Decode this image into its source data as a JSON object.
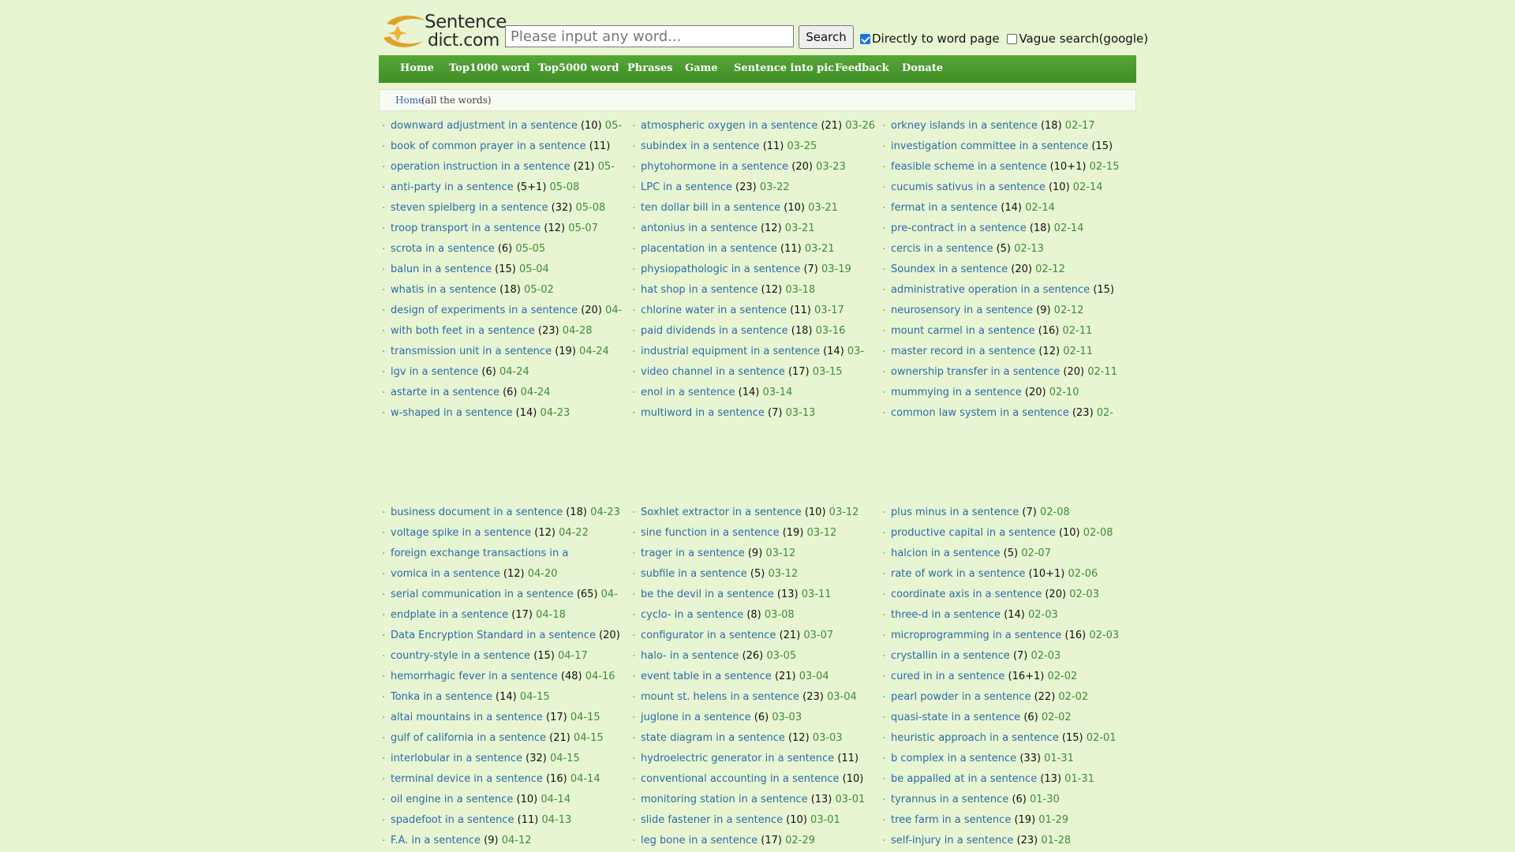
{
  "logo": {
    "line1": "Sentence",
    "line2": "dict.com"
  },
  "search": {
    "placeholder": "Please input any word...",
    "button": "Search"
  },
  "options": {
    "direct_label": "Directly to word page",
    "vague_label": "Vague search(google)"
  },
  "nav": [
    "Home",
    "Top1000 word",
    "Top5000 word",
    "Phrases",
    "Game",
    "Sentence into pic",
    "Feedback",
    "Donate"
  ],
  "breadcrumb": {
    "home": "Home",
    "rest": "(all the words)"
  },
  "columns_top": [
    [
      {
        "w": "downward adjustment in a sentence",
        "c": "(10)",
        "d": "05-"
      },
      {
        "w": "book of common prayer in a sentence",
        "c": "(11)",
        "d": ""
      },
      {
        "w": "operation instruction in a sentence",
        "c": "(21)",
        "d": "05-"
      },
      {
        "w": "anti-party in a sentence",
        "c": "(5+1)",
        "d": "05-08"
      },
      {
        "w": "steven spielberg in a sentence",
        "c": "(32)",
        "d": "05-08"
      },
      {
        "w": "troop transport in a sentence",
        "c": "(12)",
        "d": "05-07"
      },
      {
        "w": "scrota in a sentence",
        "c": "(6)",
        "d": "05-05"
      },
      {
        "w": "balun in a sentence",
        "c": "(15)",
        "d": "05-04"
      },
      {
        "w": "whatis in a sentence",
        "c": "(18)",
        "d": "05-02"
      },
      {
        "w": "design of experiments in a sentence",
        "c": "(20)",
        "d": "04-"
      },
      {
        "w": "with both feet in a sentence",
        "c": "(23)",
        "d": "04-28"
      },
      {
        "w": "transmission unit in a sentence",
        "c": "(19)",
        "d": "04-24"
      },
      {
        "w": "lgv in a sentence",
        "c": "(6)",
        "d": "04-24"
      },
      {
        "w": "astarte in a sentence",
        "c": "(6)",
        "d": "04-24"
      },
      {
        "w": "w-shaped in a sentence",
        "c": "(14)",
        "d": "04-23"
      }
    ],
    [
      {
        "w": "atmospheric oxygen in a sentence",
        "c": "(21)",
        "d": "03-26"
      },
      {
        "w": "subindex in a sentence",
        "c": "(11)",
        "d": "03-25"
      },
      {
        "w": "phytohormone in a sentence",
        "c": "(20)",
        "d": "03-23"
      },
      {
        "w": "LPC in a sentence",
        "c": "(23)",
        "d": "03-22"
      },
      {
        "w": "ten dollar bill in a sentence",
        "c": "(10)",
        "d": "03-21"
      },
      {
        "w": "antonius in a sentence",
        "c": "(12)",
        "d": "03-21"
      },
      {
        "w": "placentation in a sentence",
        "c": "(11)",
        "d": "03-21"
      },
      {
        "w": "physiopathologic in a sentence",
        "c": "(7)",
        "d": "03-19"
      },
      {
        "w": "hat shop in a sentence",
        "c": "(12)",
        "d": "03-18"
      },
      {
        "w": "chlorine water in a sentence",
        "c": "(11)",
        "d": "03-17"
      },
      {
        "w": "paid dividends in a sentence",
        "c": "(18)",
        "d": "03-16"
      },
      {
        "w": "industrial equipment in a sentence",
        "c": "(14)",
        "d": "03-"
      },
      {
        "w": "video channel in a sentence",
        "c": "(17)",
        "d": "03-15"
      },
      {
        "w": "enol in a sentence",
        "c": "(14)",
        "d": "03-14"
      },
      {
        "w": "multiword in a sentence",
        "c": "(7)",
        "d": "03-13"
      }
    ],
    [
      {
        "w": "orkney islands in a sentence",
        "c": "(18)",
        "d": "02-17"
      },
      {
        "w": "investigation committee in a sentence",
        "c": "(15)",
        "d": ""
      },
      {
        "w": "feasible scheme in a sentence",
        "c": "(10+1)",
        "d": "02-15"
      },
      {
        "w": "cucumis sativus in a sentence",
        "c": "(10)",
        "d": "02-14"
      },
      {
        "w": "fermat in a sentence",
        "c": "(14)",
        "d": "02-14"
      },
      {
        "w": "pre-contract in a sentence",
        "c": "(18)",
        "d": "02-14"
      },
      {
        "w": "cercis in a sentence",
        "c": "(5)",
        "d": "02-13"
      },
      {
        "w": "Soundex in a sentence",
        "c": "(20)",
        "d": "02-12"
      },
      {
        "w": "administrative operation in a sentence",
        "c": "(15)",
        "d": ""
      },
      {
        "w": "neurosensory in a sentence",
        "c": "(9)",
        "d": "02-12"
      },
      {
        "w": "mount carmel in a sentence",
        "c": "(16)",
        "d": "02-11"
      },
      {
        "w": "master record in a sentence",
        "c": "(12)",
        "d": "02-11"
      },
      {
        "w": "ownership transfer in a sentence",
        "c": "(20)",
        "d": "02-11"
      },
      {
        "w": "mummying in a sentence",
        "c": "(20)",
        "d": "02-10"
      },
      {
        "w": "common law system in a sentence",
        "c": "(23)",
        "d": "02-"
      }
    ]
  ],
  "columns_bottom": [
    [
      {
        "w": "business document in a sentence",
        "c": "(18)",
        "d": "04-23"
      },
      {
        "w": "voltage spike in a sentence",
        "c": "(12)",
        "d": "04-22"
      },
      {
        "w": "foreign exchange transactions in a",
        "c": "",
        "d": ""
      },
      {
        "w": "vomica in a sentence",
        "c": "(12)",
        "d": "04-20"
      },
      {
        "w": "serial communication in a sentence",
        "c": "(65)",
        "d": "04-"
      },
      {
        "w": "endplate in a sentence",
        "c": "(17)",
        "d": "04-18"
      },
      {
        "w": "Data Encryption Standard in a sentence",
        "c": "(20)",
        "d": ""
      },
      {
        "w": "country-style in a sentence",
        "c": "(15)",
        "d": "04-17"
      },
      {
        "w": "hemorrhagic fever in a sentence",
        "c": "(48)",
        "d": "04-16"
      },
      {
        "w": "Tonka in a sentence",
        "c": "(14)",
        "d": "04-15"
      },
      {
        "w": "altai mountains in a sentence",
        "c": "(17)",
        "d": "04-15"
      },
      {
        "w": "gulf of california in a sentence",
        "c": "(21)",
        "d": "04-15"
      },
      {
        "w": "interlobular in a sentence",
        "c": "(32)",
        "d": "04-15"
      },
      {
        "w": "terminal device in a sentence",
        "c": "(16)",
        "d": "04-14"
      },
      {
        "w": "oil engine in a sentence",
        "c": "(10)",
        "d": "04-14"
      },
      {
        "w": "spadefoot in a sentence",
        "c": "(11)",
        "d": "04-13"
      },
      {
        "w": "F.A. in a sentence",
        "c": "(9)",
        "d": "04-12"
      }
    ],
    [
      {
        "w": "Soxhlet extractor in a sentence",
        "c": "(10)",
        "d": "03-12"
      },
      {
        "w": "sine function in a sentence",
        "c": "(19)",
        "d": "03-12"
      },
      {
        "w": "trager in a sentence",
        "c": "(9)",
        "d": "03-12"
      },
      {
        "w": "subfile in a sentence",
        "c": "(5)",
        "d": "03-12"
      },
      {
        "w": "be the devil in a sentence",
        "c": "(13)",
        "d": "03-11"
      },
      {
        "w": "cyclo- in a sentence",
        "c": "(8)",
        "d": "03-08"
      },
      {
        "w": "configurator in a sentence",
        "c": "(21)",
        "d": "03-07"
      },
      {
        "w": "halo- in a sentence",
        "c": "(26)",
        "d": "03-05"
      },
      {
        "w": "event table in a sentence",
        "c": "(21)",
        "d": "03-04"
      },
      {
        "w": "mount st. helens in a sentence",
        "c": "(23)",
        "d": "03-04"
      },
      {
        "w": "juglone in a sentence",
        "c": "(6)",
        "d": "03-03"
      },
      {
        "w": "state diagram in a sentence",
        "c": "(12)",
        "d": "03-03"
      },
      {
        "w": "hydroelectric generator in a sentence",
        "c": "(11)",
        "d": ""
      },
      {
        "w": "conventional accounting in a sentence",
        "c": "(10)",
        "d": ""
      },
      {
        "w": "monitoring station in a sentence",
        "c": "(13)",
        "d": "03-01"
      },
      {
        "w": "slide fastener in a sentence",
        "c": "(10)",
        "d": "03-01"
      },
      {
        "w": "leg bone in a sentence",
        "c": "(17)",
        "d": "02-29"
      }
    ],
    [
      {
        "w": "plus minus in a sentence",
        "c": "(7)",
        "d": "02-08"
      },
      {
        "w": "productive capital in a sentence",
        "c": "(10)",
        "d": "02-08"
      },
      {
        "w": "halcion in a sentence",
        "c": "(5)",
        "d": "02-07"
      },
      {
        "w": "rate of work in a sentence",
        "c": "(10+1)",
        "d": "02-06"
      },
      {
        "w": "coordinate axis in a sentence",
        "c": "(20)",
        "d": "02-03"
      },
      {
        "w": "three-d in a sentence",
        "c": "(14)",
        "d": "02-03"
      },
      {
        "w": "microprogramming in a sentence",
        "c": "(16)",
        "d": "02-03"
      },
      {
        "w": "crystallin in a sentence",
        "c": "(7)",
        "d": "02-03"
      },
      {
        "w": "cured in in a sentence",
        "c": "(16+1)",
        "d": "02-02"
      },
      {
        "w": "pearl powder in a sentence",
        "c": "(22)",
        "d": "02-02"
      },
      {
        "w": "quasi-state in a sentence",
        "c": "(6)",
        "d": "02-02"
      },
      {
        "w": "heuristic approach in a sentence",
        "c": "(15)",
        "d": "02-01"
      },
      {
        "w": "b complex in a sentence",
        "c": "(33)",
        "d": "01-31"
      },
      {
        "w": "be appalled at in a sentence",
        "c": "(13)",
        "d": "01-31"
      },
      {
        "w": "tyrannus in a sentence",
        "c": "(6)",
        "d": "01-30"
      },
      {
        "w": "tree farm in a sentence",
        "c": "(19)",
        "d": "01-29"
      },
      {
        "w": "self-injury in a sentence",
        "c": "(23)",
        "d": "01-28"
      }
    ]
  ]
}
